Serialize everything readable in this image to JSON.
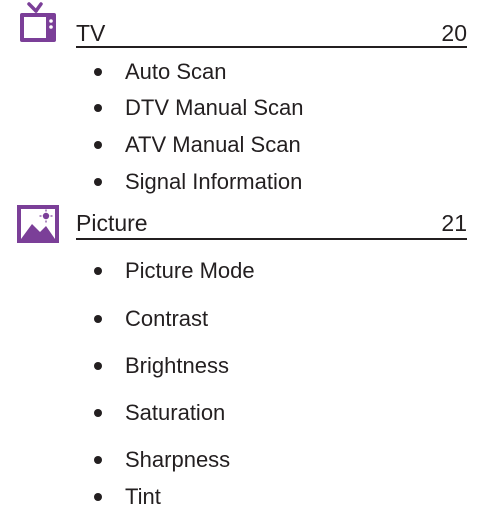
{
  "sections": [
    {
      "icon": "tv-icon",
      "title": "TV",
      "page": "20",
      "items": [
        "Auto Scan",
        "DTV Manual Scan",
        "ATV Manual Scan",
        "Signal Information"
      ]
    },
    {
      "icon": "picture-icon",
      "title": "Picture",
      "page": "21",
      "items": [
        "Picture Mode",
        "Contrast",
        "Brightness",
        "Saturation",
        "Sharpness",
        "Tint"
      ]
    }
  ],
  "colors": {
    "accent": "#7b3f98",
    "text": "#231f20"
  }
}
